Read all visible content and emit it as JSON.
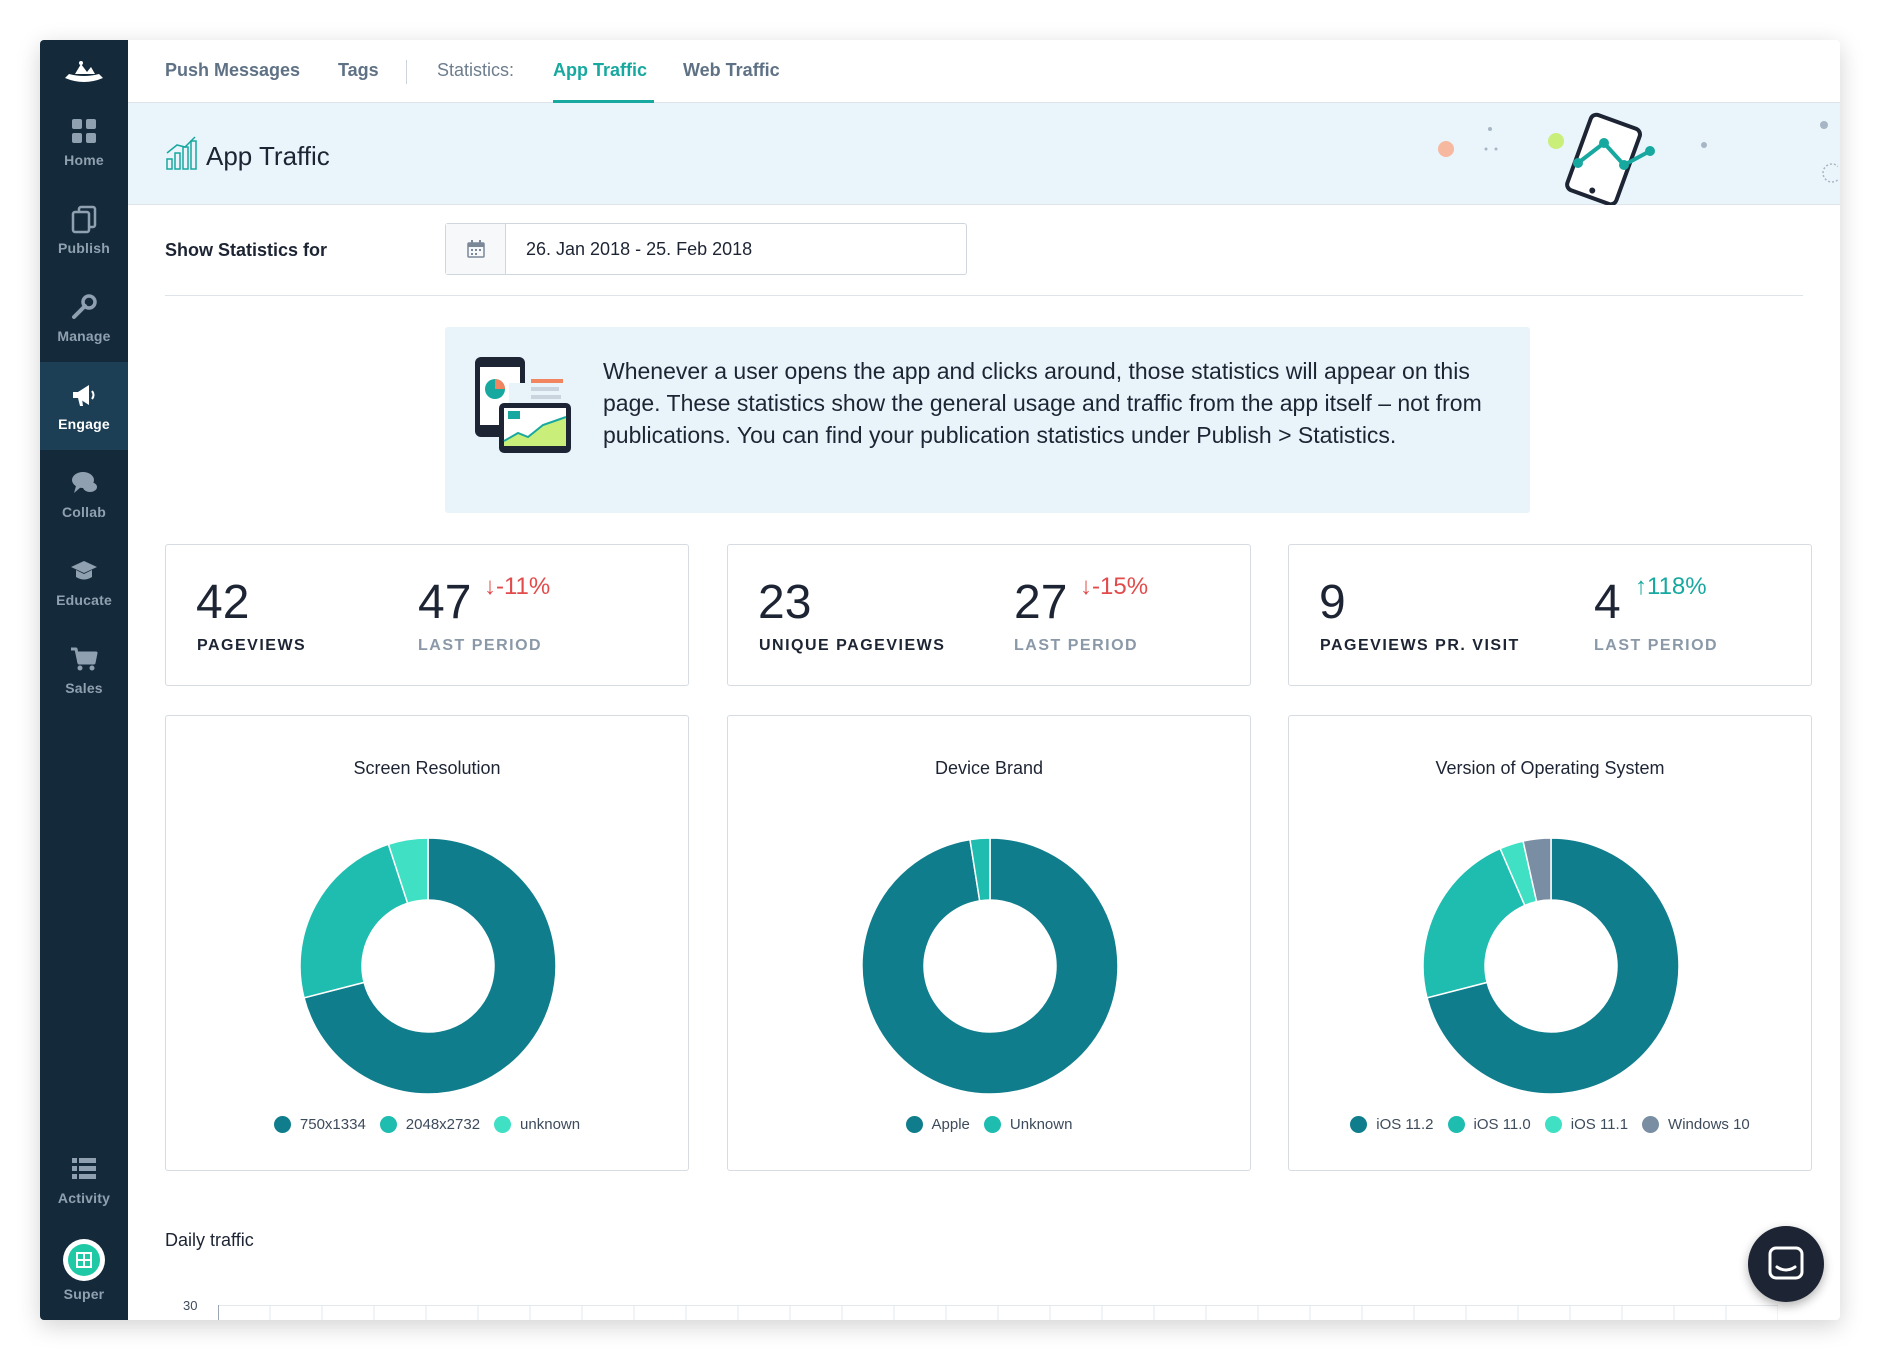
{
  "sidebar": {
    "items": [
      {
        "label": "Home",
        "icon": "grid-icon"
      },
      {
        "label": "Publish",
        "icon": "copy-icon"
      },
      {
        "label": "Manage",
        "icon": "wrench-icon"
      },
      {
        "label": "Engage",
        "icon": "megaphone-icon",
        "active": true
      },
      {
        "label": "Collab",
        "icon": "chat-bubbles-icon"
      },
      {
        "label": "Educate",
        "icon": "graduation-cap-icon"
      },
      {
        "label": "Sales",
        "icon": "cart-icon"
      }
    ],
    "bottom": [
      {
        "label": "Activity",
        "icon": "list-icon"
      },
      {
        "label": "Super",
        "icon": "avatar-icon"
      }
    ]
  },
  "topnav": {
    "push_messages": "Push Messages",
    "tags": "Tags",
    "statistics_label": "Statistics:",
    "app_traffic": "App Traffic",
    "web_traffic": "Web Traffic"
  },
  "header": {
    "title": "App Traffic"
  },
  "controls": {
    "show_statistics_label": "Show Statistics for",
    "date_range": "26. Jan 2018 - 25. Feb 2018"
  },
  "info": {
    "text": "Whenever a user opens the app and clicks around, those statistics will appear on this page. These statistics show the general usage and traffic from the app itself – not from publications. You can find your publication statistics under Publish > Statistics."
  },
  "kpis": [
    {
      "value": "42",
      "label": "PAGEVIEWS",
      "last_value": "47",
      "last_label": "LAST PERIOD",
      "delta": "-11%",
      "direction": "down"
    },
    {
      "value": "23",
      "label": "UNIQUE PAGEVIEWS",
      "last_value": "27",
      "last_label": "LAST PERIOD",
      "delta": "-15%",
      "direction": "down"
    },
    {
      "value": "9",
      "label": "PAGEVIEWS PR. VISIT",
      "last_value": "4",
      "last_label": "LAST PERIOD",
      "delta": "118%",
      "direction": "up"
    }
  ],
  "colors": {
    "sidebar_bg": "#142a3b",
    "accent": "#17a8a0",
    "negative": "#e24b4b",
    "series_dark": "#0f7d8c",
    "series_teal": "#1fbcb0",
    "series_light": "#3fe0c4",
    "series_gray": "#7a8ea3"
  },
  "chart_data": [
    {
      "type": "pie",
      "title": "Screen Resolution",
      "series": [
        {
          "name": "750x1334",
          "value": 71,
          "color": "#0f7d8c"
        },
        {
          "name": "2048x2732",
          "value": 24,
          "color": "#1fbcb0"
        },
        {
          "name": "unknown",
          "value": 5,
          "color": "#3fe0c4"
        }
      ]
    },
    {
      "type": "pie",
      "title": "Device Brand",
      "series": [
        {
          "name": "Apple",
          "value": 97.5,
          "color": "#0f7d8c"
        },
        {
          "name": "Unknown",
          "value": 2.5,
          "color": "#1fbcb0"
        }
      ]
    },
    {
      "type": "pie",
      "title": "Version of Operating System",
      "series": [
        {
          "name": "iOS 11.2",
          "value": 71,
          "color": "#0f7d8c"
        },
        {
          "name": "iOS 11.0",
          "value": 22.5,
          "color": "#1fbcb0"
        },
        {
          "name": "iOS 11.1",
          "value": 3,
          "color": "#3fe0c4"
        },
        {
          "name": "Windows 10",
          "value": 3.5,
          "color": "#7a8ea3"
        }
      ]
    },
    {
      "type": "line",
      "title": "Daily traffic",
      "ylim": [
        0,
        30
      ],
      "y_tick_labels": [
        "30"
      ]
    }
  ]
}
